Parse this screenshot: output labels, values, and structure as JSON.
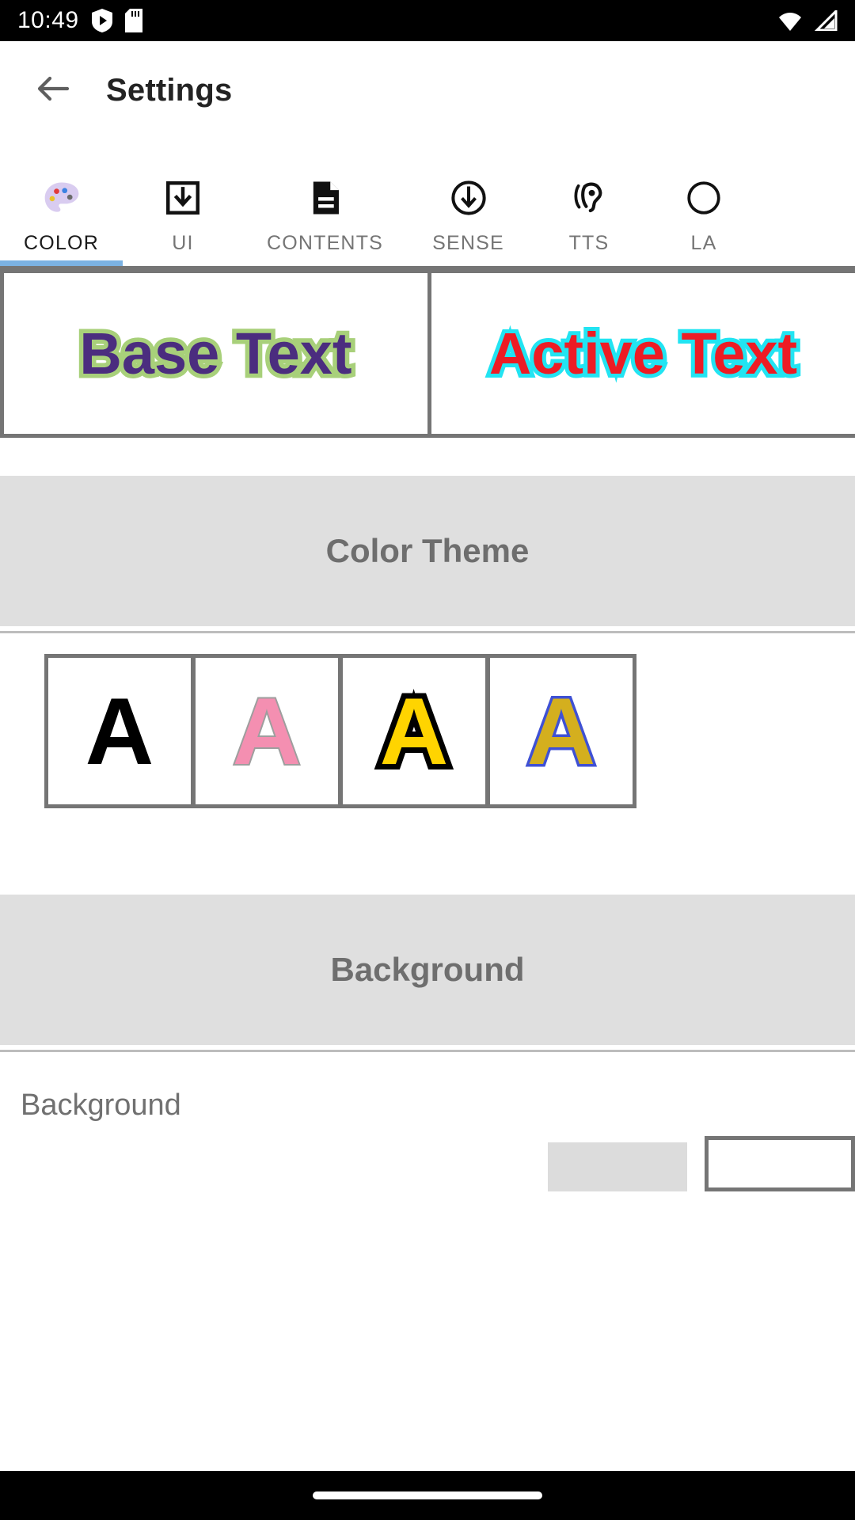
{
  "status_bar": {
    "time": "10:49",
    "left_icons": [
      "shield-play-icon",
      "sd-card-icon"
    ],
    "right_icons": [
      "wifi-icon",
      "cell-signal-icon"
    ],
    "background": "#000000"
  },
  "app_bar": {
    "back_icon": "arrow-left-icon",
    "title": "Settings"
  },
  "tabs": {
    "active_index": 0,
    "indicator_color": "#7BB2E3",
    "items": [
      {
        "label": "COLOR",
        "icon": "palette-icon"
      },
      {
        "label": "UI",
        "icon": "download-box-icon"
      },
      {
        "label": "CONTENTS",
        "icon": "document-icon"
      },
      {
        "label": "SENSE",
        "icon": "circle-arrow-down-icon"
      },
      {
        "label": "TTS",
        "icon": "ear-hearing-icon"
      },
      {
        "label": "LA",
        "icon": "language-icon"
      }
    ]
  },
  "preview": {
    "base": {
      "text": "Base Text",
      "fill": "#4B2D7F",
      "stroke": "#A8D07A"
    },
    "active": {
      "text": "Active Text",
      "fill": "#ED1C24",
      "stroke": "#22E4F2"
    }
  },
  "color_theme": {
    "title": "Color Theme",
    "swatches": [
      {
        "letter": "A",
        "fill": "#000000",
        "stroke": "none"
      },
      {
        "letter": "A",
        "fill": "#F48FB1",
        "stroke": "#9E9E9E"
      },
      {
        "letter": "A",
        "fill": "#FFD400",
        "stroke": "#000000"
      },
      {
        "letter": "A",
        "fill": "#D4AF1E",
        "stroke": "#3F51D4"
      }
    ]
  },
  "background_section": {
    "title": "Background",
    "rows": [
      {
        "label": "Background"
      }
    ]
  },
  "nav_bar": {
    "gesture_pill": "home-pill"
  }
}
